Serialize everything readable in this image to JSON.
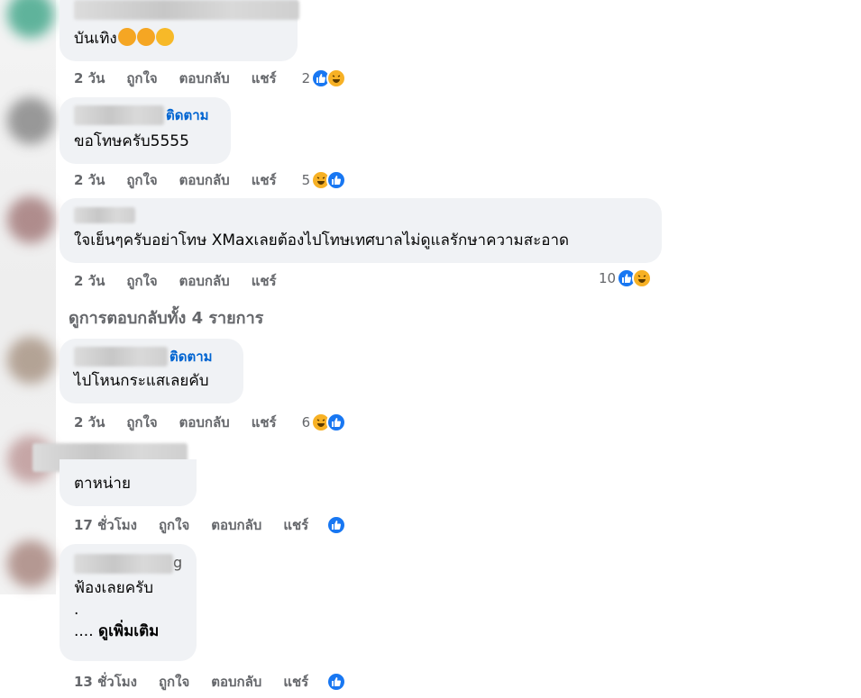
{
  "comments": [
    {
      "text": "บันเทิง",
      "emojis": [
        "rolling-laughing-emoji",
        "rolling-laughing-emoji",
        "grinning-emoji"
      ],
      "time": "2 วัน",
      "like": "ถูกใจ",
      "reply": "ตอบกลับ",
      "share": "แชร์",
      "reaction_count": "2",
      "reactions": [
        "like",
        "haha"
      ]
    },
    {
      "follow": "ติดตาม",
      "text": "ขอโทษครับ5555",
      "time": "2 วัน",
      "like": "ถูกใจ",
      "reply": "ตอบกลับ",
      "share": "แชร์",
      "reaction_count": "5",
      "reactions": [
        "haha",
        "like"
      ]
    },
    {
      "text": "ใจเย็นๆครับอย่าโทษ XMaxเลยต้องไปโทษเทศบาลไม่ดูแลรักษาความสะอาด",
      "time": "2 วัน",
      "like": "ถูกใจ",
      "reply": "ตอบกลับ",
      "share": "แชร์",
      "reaction_count": "10",
      "reactions": [
        "like",
        "haha"
      ]
    },
    {
      "follow": "ติดตาม",
      "text": "ไปโหนกระแสเลยคับ",
      "time": "2 วัน",
      "like": "ถูกใจ",
      "reply": "ตอบกลับ",
      "share": "แชร์",
      "reaction_count": "6",
      "reactions": [
        "haha",
        "like"
      ]
    },
    {
      "text": "ตาหน่าย",
      "time": "17 ชั่วโมง",
      "like": "ถูกใจ",
      "reply": "ตอบกลับ",
      "share": "แชร์",
      "reactions": [
        "like"
      ]
    },
    {
      "name_tail": "g",
      "text": "ฟ้องเลยครับ",
      "line2": ".",
      "line3_prefix": "....",
      "see_more": "ดูเพิ่มเติม",
      "time": "13 ชั่วโมง",
      "like": "ถูกใจ",
      "reply": "ตอบกลับ",
      "share": "แชร์",
      "reactions": [
        "like"
      ]
    }
  ],
  "view_replies": "ดูการตอบกลับทั้ง 4 รายการ",
  "colors": {
    "like": "#1877f2",
    "haha": "#f7b125",
    "follow": "#0064d1",
    "meta": "#65676b",
    "bubble": "#f0f2f5"
  }
}
